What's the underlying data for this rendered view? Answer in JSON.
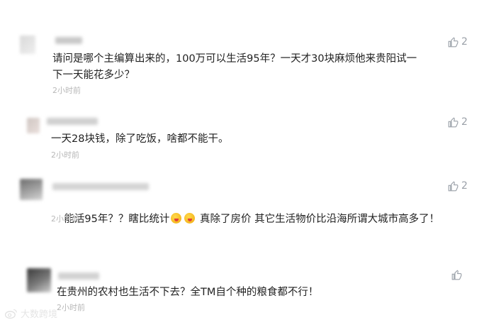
{
  "comments": [
    {
      "text": "请问是哪个主编算出来的，100万可以生活95年？一天才30块麻烦他来贵阳试一下一天能花多少？",
      "time": "2小时前",
      "likes": "2"
    },
    {
      "text": "一天28块钱，除了吃饭，啥都不能干。",
      "time": "2小时前",
      "likes": "2"
    },
    {
      "text_before_emoji": "能活95年？？瞎比统计",
      "text_after_emoji": " 真除了房价 其它生活物价比沿海所谓大城市高多了！",
      "time": "2小时前",
      "likes": "2"
    },
    {
      "text": "在贵州的农村也生活不下去？全TM自个种的粮食都不行！",
      "time": "2小时前",
      "likes": ""
    }
  ],
  "icons": {
    "like": "thumbs-up-icon",
    "emoji": "tongue-out-emoji-icon",
    "watermark": "weibo-logo-icon"
  },
  "watermark": {
    "text": "大数跨境"
  },
  "colors": {
    "text": "#222222",
    "meta": "#b8b8b8",
    "like": "#9aa0a8"
  }
}
